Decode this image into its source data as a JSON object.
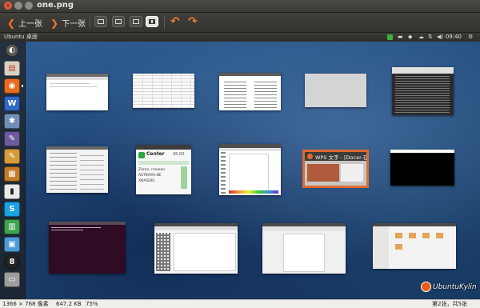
{
  "window": {
    "title": "one.png"
  },
  "toolbar": {
    "prev_label": "上一张",
    "next_label": "下一张"
  },
  "panel": {
    "title": "Ubuntu 桌面",
    "clock": "09:40"
  },
  "spread": {
    "selected_window_title": "WPS 文字 - [Docer-在...",
    "chat_window_title": "Center",
    "chat_window_time": "45:00",
    "chat_contacts": [
      "Zoran, nroleen",
      "ASTIRAYA.NE",
      "XNASDIS"
    ]
  },
  "statusbar": {
    "dimensions": "1366 × 768 像素",
    "filesize": "647.2 KB",
    "zoom": "75%",
    "page": "第2张，共5张"
  },
  "watermark": {
    "text": "UbuntuKylin"
  },
  "colors": {
    "accent": "#e06a30",
    "launcher": "#1e1e1e",
    "desktop": "#2a5787"
  }
}
